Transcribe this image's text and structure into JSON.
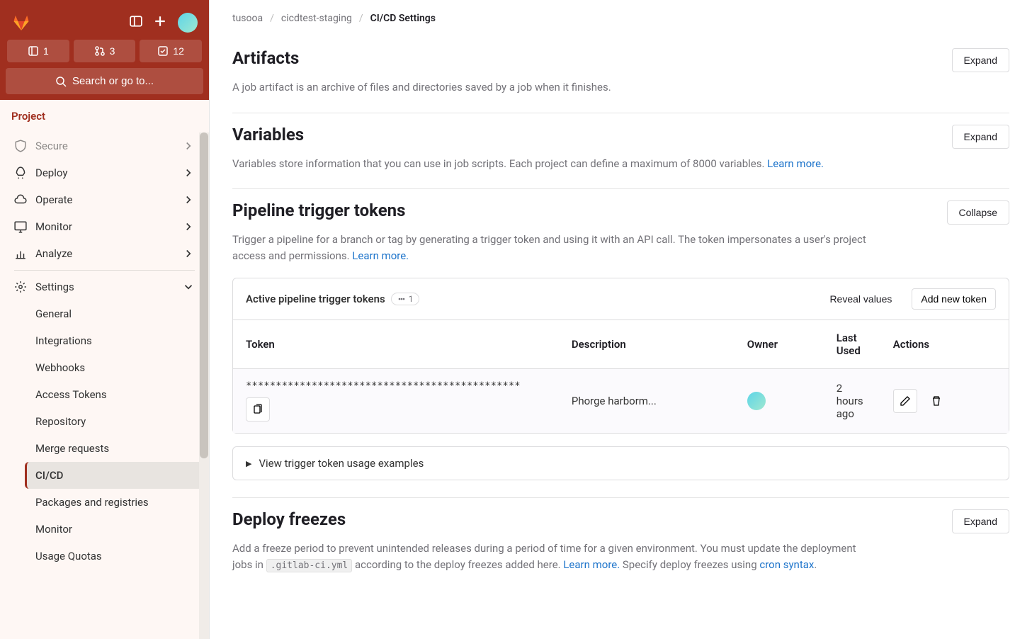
{
  "header": {
    "counters": {
      "issues": "1",
      "mrs": "3",
      "todos": "12"
    },
    "search_label": "Search or go to..."
  },
  "sidebar": {
    "project_label": "Project",
    "nav": [
      {
        "label": "Secure",
        "faded": true
      },
      {
        "label": "Deploy"
      },
      {
        "label": "Operate"
      },
      {
        "label": "Monitor"
      },
      {
        "label": "Analyze"
      }
    ],
    "settings_label": "Settings",
    "settings_sub": [
      {
        "label": "General"
      },
      {
        "label": "Integrations"
      },
      {
        "label": "Webhooks"
      },
      {
        "label": "Access Tokens"
      },
      {
        "label": "Repository"
      },
      {
        "label": "Merge requests"
      },
      {
        "label": "CI/CD",
        "active": true
      },
      {
        "label": "Packages and registries"
      },
      {
        "label": "Monitor"
      },
      {
        "label": "Usage Quotas"
      }
    ]
  },
  "breadcrumb": {
    "items": [
      "tusooa",
      "cicdtest-staging"
    ],
    "current": "CI/CD Settings"
  },
  "sections": {
    "artifacts": {
      "title": "Artifacts",
      "desc": "A job artifact is an archive of files and directories saved by a job when it finishes.",
      "btn": "Expand"
    },
    "variables": {
      "title": "Variables",
      "desc": "Variables store information that you can use in job scripts. Each project can define a maximum of 8000 variables. ",
      "link": "Learn more.",
      "btn": "Expand"
    },
    "tokens": {
      "title": "Pipeline trigger tokens",
      "desc": "Trigger a pipeline for a branch or tag by generating a trigger token and using it with an API call. The token impersonates a user's project access and permissions. ",
      "link": "Learn more.",
      "btn": "Collapse",
      "panel_title": "Active pipeline trigger tokens",
      "badge_count": "1",
      "reveal_label": "Reveal values",
      "add_label": "Add new token",
      "columns": {
        "token": "Token",
        "description": "Description",
        "owner": "Owner",
        "last_used": "Last Used",
        "actions": "Actions"
      },
      "row": {
        "token": "**********************************************",
        "description": "Phorge harborm...",
        "last_used": "2 hours ago"
      },
      "usage_label": "View trigger token usage examples"
    },
    "freezes": {
      "title": "Deploy freezes",
      "btn": "Expand",
      "desc1": "Add a freeze period to prevent unintended releases during a period of time for a given environment. You must update the deployment jobs in ",
      "code": ".gitlab-ci.yml",
      "desc2": " according to the deploy freezes added here. ",
      "link1": "Learn more.",
      "desc3": " Specify deploy freezes using ",
      "link2": "cron syntax",
      "desc4": "."
    }
  }
}
